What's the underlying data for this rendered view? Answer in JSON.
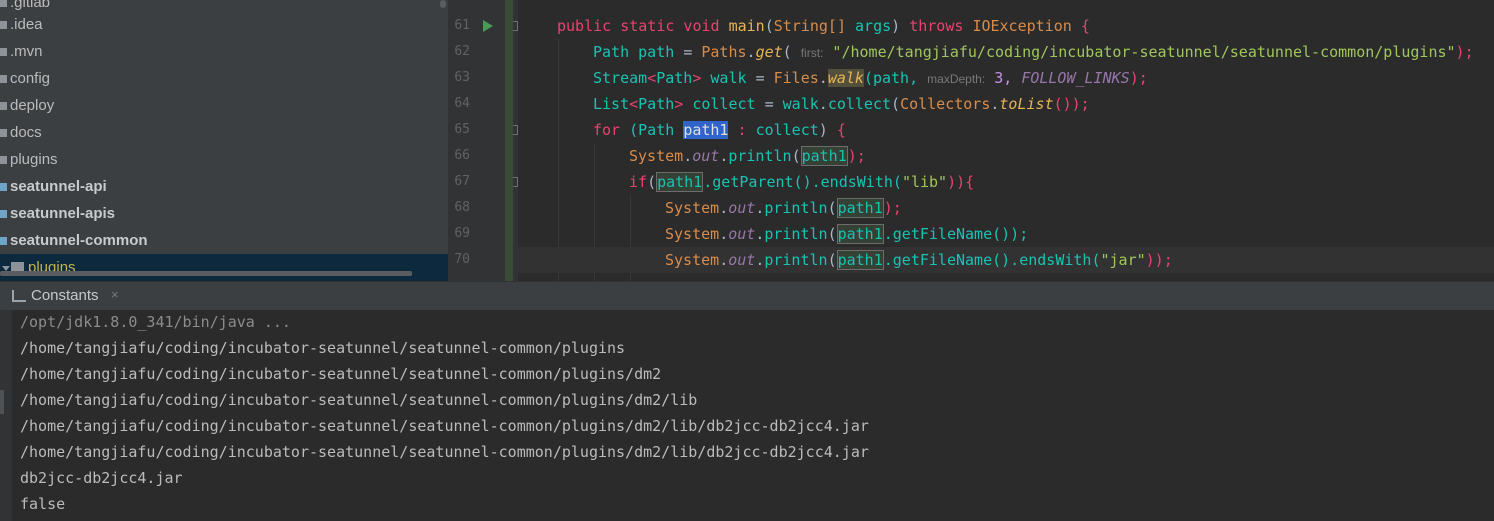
{
  "project_tree": {
    "items": [
      {
        "label": ".gitlab"
      },
      {
        "label": ".idea"
      },
      {
        "label": ".mvn"
      },
      {
        "label": "config"
      },
      {
        "label": "deploy"
      },
      {
        "label": "docs"
      },
      {
        "label": "plugins"
      },
      {
        "label": "seatunnel-api"
      },
      {
        "label": "seatunnel-apis"
      },
      {
        "label": "seatunnel-common"
      },
      {
        "label": "plugins"
      }
    ]
  },
  "editor": {
    "line_numbers": [
      "61",
      "62",
      "63",
      "64",
      "65",
      "66",
      "67",
      "68",
      "69",
      "70"
    ],
    "l61": {
      "kw1": "public static void",
      "fn": "main",
      "p1": "(",
      "type": "String[]",
      "arg": "args",
      "p2": ")",
      "kw2": "throws",
      "exc": "IOException",
      "brace": "{"
    },
    "l62": {
      "type": "Path",
      "var": "path",
      "eq": "=",
      "cls": "Paths",
      "dot": ".",
      "fn": "get",
      "p1": "(",
      "hint": "first:",
      "str": "\"/home/tangjiafu/coding/incubator-seatunnel/seatunnel-common/plugins\"",
      "end": ");"
    },
    "l63": {
      "type": "Stream",
      "lt": "<",
      "gen": "Path",
      "gt": ">",
      "var": "walk",
      "eq": "=",
      "cls": "Files",
      "dot": ".",
      "fn": "walk",
      "p1": "(path,",
      "hint": "maxDepth:",
      "num": "3,",
      "const": "FOLLOW_LINKS",
      "end": ");"
    },
    "l64": {
      "type": "List",
      "lt": "<",
      "gen": "Path",
      "gt": ">",
      "var": "collect",
      "eq": "=",
      "obj": "walk",
      "dot1": ".",
      "fn1": "collect",
      "p1": "(",
      "cls": "Collectors",
      "dot2": ".",
      "fn2": "toList",
      "end": "());"
    },
    "l65": {
      "kw": "for",
      "p1": "(Path",
      "var": "path1",
      "colon": ":",
      "coll": "collect",
      "p2": ")",
      "brace": "{"
    },
    "l66": {
      "cls": "System",
      "dot1": ".",
      "field": "out",
      "dot2": ".",
      "fn": "println",
      "p1": "(",
      "var": "path1",
      "end": ");"
    },
    "l67": {
      "kw": "if",
      "p1": "(",
      "var": "path1",
      "rest": ".getParent().endsWith(",
      "str": "\"lib\"",
      "end": ")){"
    },
    "l68": {
      "cls": "System",
      "dot1": ".",
      "field": "out",
      "dot2": ".",
      "fn": "println",
      "p1": "(",
      "var": "path1",
      "end": ");"
    },
    "l69": {
      "cls": "System",
      "dot1": ".",
      "field": "out",
      "dot2": ".",
      "fn": "println",
      "p1": "(",
      "var": "path1",
      "rest": ".getFileName());"
    },
    "l70": {
      "cls": "System",
      "dot1": ".",
      "field": "out",
      "dot2": ".",
      "fn": "println",
      "p1": "(",
      "var": "path1",
      "rest": ".getFileName().endsWith(",
      "str": "\"jar\"",
      "end": "));"
    }
  },
  "run_window": {
    "tab_label": "Constants",
    "tab_close": "×",
    "console_lines": [
      "/opt/jdk1.8.0_341/bin/java ...",
      "/home/tangjiafu/coding/incubator-seatunnel/seatunnel-common/plugins",
      "/home/tangjiafu/coding/incubator-seatunnel/seatunnel-common/plugins/dm2",
      "/home/tangjiafu/coding/incubator-seatunnel/seatunnel-common/plugins/dm2/lib",
      "/home/tangjiafu/coding/incubator-seatunnel/seatunnel-common/plugins/dm2/lib/db2jcc-db2jcc4.jar",
      "/home/tangjiafu/coding/incubator-seatunnel/seatunnel-common/plugins/dm2/lib/db2jcc-db2jcc4.jar",
      "db2jcc-db2jcc4.jar",
      "false"
    ]
  },
  "icons": {
    "run_gutter": "run-arrow-icon",
    "fold": "fold-icon",
    "folder": "folder-icon",
    "run_tab": "console-icon"
  },
  "colors": {
    "keyword": "#cc7832",
    "string": "#9fc75b",
    "type": "#19c3b3",
    "selection": "#2f65ca",
    "run_icon": "#499c54"
  }
}
